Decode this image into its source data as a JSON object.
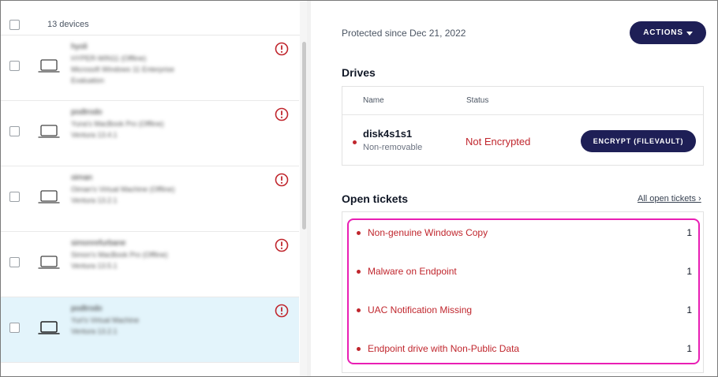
{
  "device_list": {
    "count_label": "13 devices",
    "rows": [
      {
        "name": "hyoli",
        "line1": "HYPER-WIN11 (Offline)",
        "line2": "Microsoft Windows 11 Enterprise",
        "line3": "Evaluation",
        "selected": false
      },
      {
        "name": "podtrodo",
        "line1": "Yuna's MacBook Pro (Offline)",
        "line2": "Ventura 13.4.1",
        "line3": "",
        "selected": false
      },
      {
        "name": "oiman",
        "line1": "Oiman's Virtual Machine (Offline)",
        "line2": "Ventura 13.2.1",
        "line3": "",
        "selected": false
      },
      {
        "name": "simonrefurbane",
        "line1": "Simon's MacBook Pro (Offline)",
        "line2": "Ventura 13.5.1",
        "line3": "",
        "selected": false
      },
      {
        "name": "podtrodo",
        "line1": "Yuri's Virtual Machine",
        "line2": "Ventura 13.2.1",
        "line3": "",
        "selected": true
      }
    ]
  },
  "detail": {
    "protected_since": "Protected since Dec 21, 2022",
    "actions_label": "ACTIONS",
    "drives": {
      "title": "Drives",
      "col_name": "Name",
      "col_status": "Status",
      "drive_name": "disk4s1s1",
      "drive_type": "Non-removable",
      "drive_status": "Not Encrypted",
      "encrypt_label": "ENCRYPT (FILEVAULT)"
    },
    "tickets": {
      "title": "Open tickets",
      "all_link": "All open tickets ›",
      "items": [
        {
          "label": "Non-genuine Windows Copy",
          "count": "1"
        },
        {
          "label": "Malware on Endpoint",
          "count": "1"
        },
        {
          "label": "UAC Notification Missing",
          "count": "1"
        },
        {
          "label": "Endpoint drive with Non-Public Data",
          "count": "1"
        }
      ]
    }
  },
  "colors": {
    "primary_button": "#1e1f56",
    "danger_text": "#c0262d",
    "highlight_border": "#e91eb4",
    "selected_row": "#e3f4fb"
  },
  "icons": {
    "row_device": "laptop-icon",
    "row_alert": "alert-circle-icon",
    "actions_caret": "caret-down-icon"
  }
}
